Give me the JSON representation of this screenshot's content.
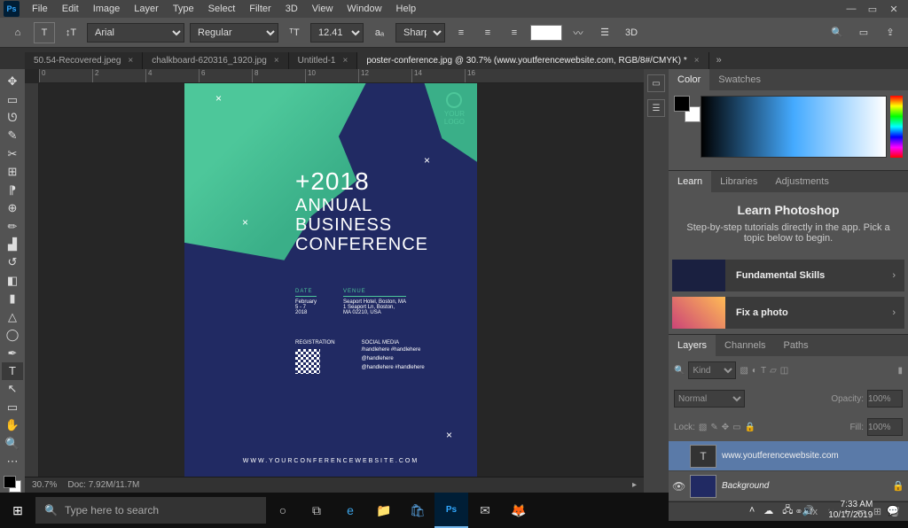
{
  "menu": {
    "items": [
      "File",
      "Edit",
      "Image",
      "Layer",
      "Type",
      "Select",
      "Filter",
      "3D",
      "View",
      "Window",
      "Help"
    ]
  },
  "optbar": {
    "font": "Arial",
    "weight": "Regular",
    "size": "12.41 pt",
    "aa": "Sharp"
  },
  "tabs": [
    {
      "label": "50.54-Recovered.jpeg",
      "active": false
    },
    {
      "label": "chalkboard-620316_1920.jpg",
      "active": false
    },
    {
      "label": "Untitled-1",
      "active": false
    },
    {
      "label": "poster-conference.jpg @ 30.7% (www.youtferencewebsite.com, RGB/8#/CMYK) *",
      "active": true
    }
  ],
  "rulerH": [
    "0",
    "2",
    "4",
    "6",
    "8",
    "10",
    "12",
    "14",
    "16"
  ],
  "status": {
    "zoom": "30.7%",
    "doc": "Doc: 7.92M/11.7M"
  },
  "panels": {
    "color": {
      "tabs": [
        "Color",
        "Swatches"
      ]
    },
    "learn": {
      "tabs": [
        "Learn",
        "Libraries",
        "Adjustments"
      ],
      "title": "Learn Photoshop",
      "subtitle": "Step-by-step tutorials directly in the app. Pick a topic below to begin.",
      "cards": [
        "Fundamental Skills",
        "Fix a photo"
      ]
    },
    "layers": {
      "tabs": [
        "Layers",
        "Channels",
        "Paths"
      ],
      "filter": "Kind",
      "blend": "Normal",
      "opacityLabel": "Opacity:",
      "opacity": "100%",
      "lockLabel": "Lock:",
      "fillLabel": "Fill:",
      "fill": "100%",
      "items": [
        {
          "name": "www.youtferencewebsite.com",
          "visible": false,
          "type": "text",
          "selected": true
        },
        {
          "name": "Background",
          "visible": true,
          "type": "image",
          "selected": false,
          "locked": true
        }
      ]
    }
  },
  "poster": {
    "logo": "YOUR\nLOGO",
    "year": "+2018",
    "title": "ANNUAL\nBUSINESS\nCONFERENCE",
    "dateLabel": "DATE",
    "date": "February\n5 - 7\n2018",
    "venueLabel": "VENUE",
    "venue": "Seaport Hotel, Boston, MA\n1 Seaport Ln, Boston,\nMA 02210, USA",
    "regLabel": "REGISTRATION",
    "socialLabel": "SOCIAL MEDIA",
    "social": "/handlehere #handlehere\n@handlehere\n@handlehere #handlehere",
    "footer": "WWW.YOURCONFERENCEWEBSITE.COM"
  },
  "taskbar": {
    "search": "Type here to search",
    "time": "7:33 AM",
    "date": "10/17/2019"
  }
}
